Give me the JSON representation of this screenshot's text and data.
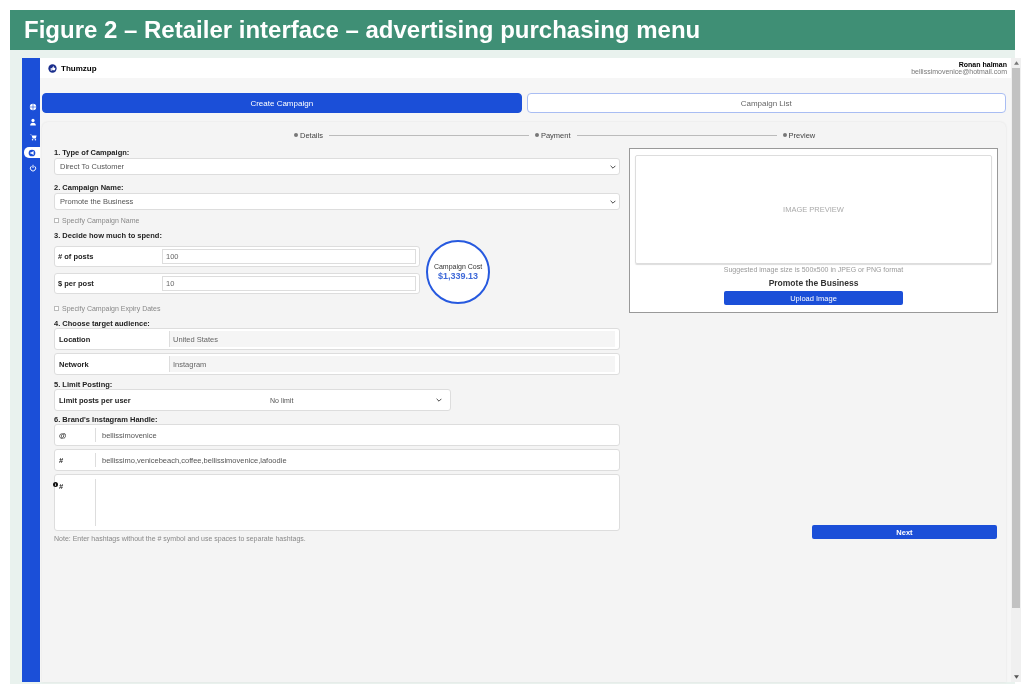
{
  "caption": "Figure 2 – Retailer interface – advertising purchasing menu",
  "header": {
    "brand": "Thumzup",
    "user_name": "Ronan halman",
    "user_email": "bellissimovenice@hotmail.com"
  },
  "sidebar": {
    "items": [
      {
        "kind": "globe",
        "selected": false
      },
      {
        "kind": "user",
        "selected": false
      },
      {
        "kind": "cart",
        "selected": false
      },
      {
        "kind": "megaphone",
        "selected": true
      },
      {
        "kind": "power",
        "selected": false
      }
    ]
  },
  "tabs": [
    {
      "label": "Create Campaign",
      "selected": true
    },
    {
      "label": "Campaign List",
      "selected": false
    }
  ],
  "steps": [
    "Details",
    "Payment",
    "Preview"
  ],
  "form": {
    "type_label": "1. Type of Campaign:",
    "type_value": "Direct To Customer",
    "name_label": "2. Campaign Name:",
    "name_value": "Promote the Business",
    "name_check": {
      "label": "Specify Campaign Name",
      "checked": false
    },
    "spend_label": "3. Decide how much to spend:",
    "spend_rows": [
      {
        "label": "# of posts",
        "value": "100"
      },
      {
        "label": "$ per post",
        "value": "10"
      }
    ],
    "cost": {
      "label": "Campaign Cost",
      "value": "$1,339.13"
    },
    "dates_check": {
      "label": "Specify Campaign Expiry Dates",
      "checked": false
    },
    "audience_label": "4. Choose target audience:",
    "audience_rows": [
      {
        "label": "Location",
        "value": "United States"
      },
      {
        "label": "Network",
        "value": "Instagram"
      }
    ],
    "limit_label": "5. Limit Posting:",
    "limit": {
      "label": "Limit posts per user",
      "value": "No limit"
    },
    "handle_label": "6. Brand's Instagram Handle:",
    "handle_rows": [
      {
        "kind": "line",
        "label": "@",
        "value": "bellissimovenice"
      },
      {
        "kind": "line",
        "label": "#",
        "value": "bellissimo,venicebeach,coffee,bellissimovenice,lafoodie"
      },
      {
        "kind": "area",
        "label": "#",
        "value": ""
      }
    ],
    "note": "Note: Enter hashtags without the # symbol and use spaces to separate hashtags."
  },
  "preview": {
    "placeholder": "IMAGE PREVIEW",
    "hint": "Suggested image size is 500x500 in JPEG or PNG format",
    "title": "Promote the Business",
    "button": "Upload Image"
  },
  "next_button": "Next"
}
